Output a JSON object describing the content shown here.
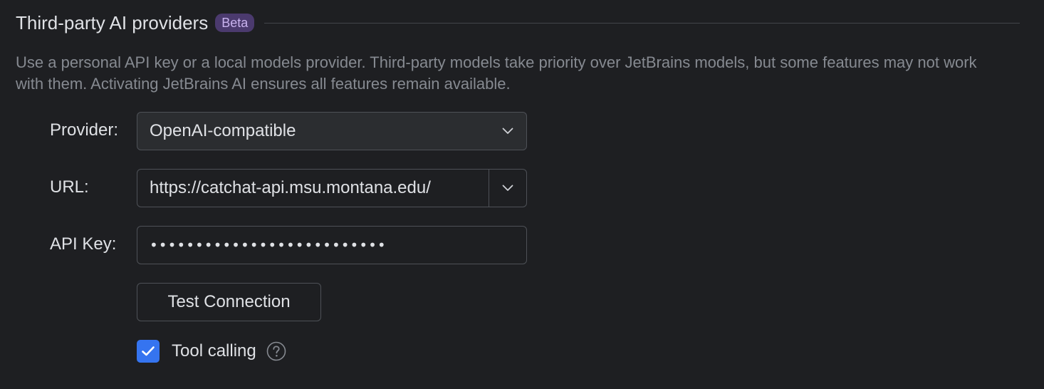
{
  "section": {
    "title": "Third-party AI providers",
    "badge": "Beta",
    "description": "Use a personal API key or a local models provider. Third-party models take priority over JetBrains models, but some features may not work with them. Activating JetBrains AI ensures all features remain available."
  },
  "form": {
    "provider": {
      "label": "Provider:",
      "value": "OpenAI-compatible",
      "icon": "chevron-down-icon"
    },
    "url": {
      "label": "URL:",
      "value": "https://catchat-api.msu.montana.edu/",
      "icon": "chevron-down-icon"
    },
    "api_key": {
      "label": "API Key:",
      "value": "••••••••••••••••••••••••••"
    },
    "test_button_label": "Test Connection",
    "tool_calling": {
      "label": "Tool calling",
      "checked": true,
      "help_icon": "question-circle-icon"
    }
  },
  "colors": {
    "background": "#1e1f22",
    "accent": "#3574f0",
    "badge_bg": "#4b3a6e",
    "badge_text": "#c9b3ef",
    "muted_text": "#868a91",
    "border": "#4e5157"
  }
}
